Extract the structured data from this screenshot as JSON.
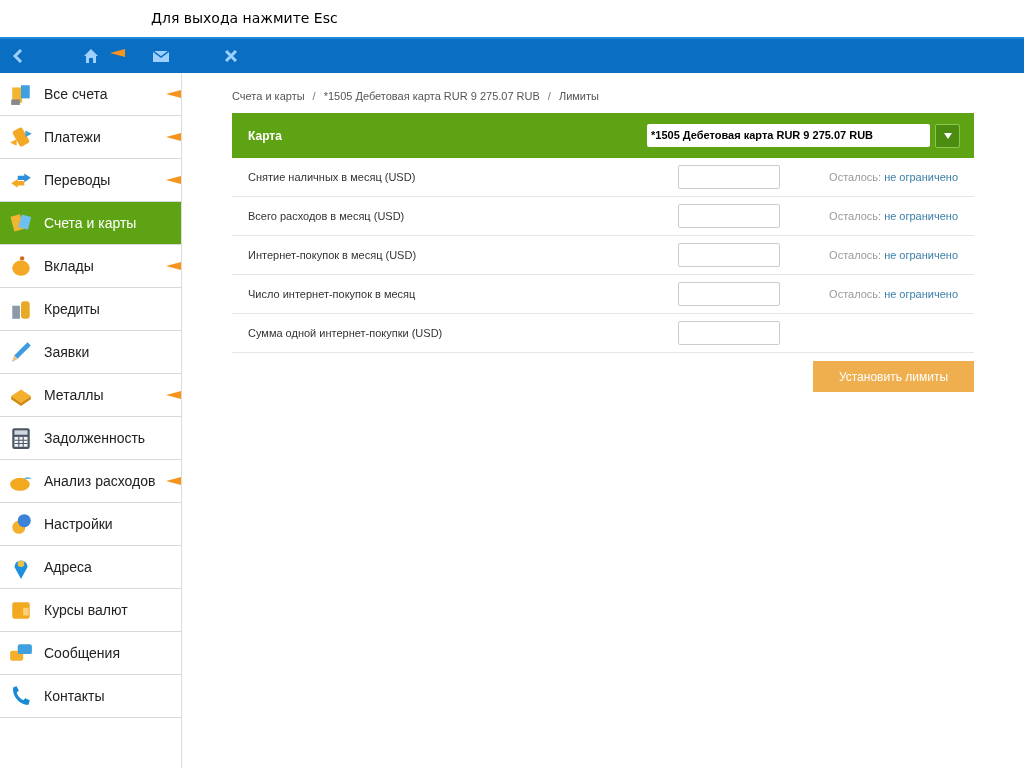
{
  "hint": "Для выхода нажмите Esc",
  "toolbar": {
    "home_marker": true
  },
  "sidebar": {
    "items": [
      {
        "label": "Все счета",
        "selected": false,
        "marker": true
      },
      {
        "label": "Платежи",
        "selected": false,
        "marker": true
      },
      {
        "label": "Переводы",
        "selected": false,
        "marker": true
      },
      {
        "label": "Счета и карты",
        "selected": true,
        "marker": false
      },
      {
        "label": "Вклады",
        "selected": false,
        "marker": true
      },
      {
        "label": "Кредиты",
        "selected": false,
        "marker": false
      },
      {
        "label": "Заявки",
        "selected": false,
        "marker": false
      },
      {
        "label": "Металлы",
        "selected": false,
        "marker": true
      },
      {
        "label": "Задолженность",
        "selected": false,
        "marker": false
      },
      {
        "label": "Анализ расходов",
        "selected": false,
        "marker": true
      },
      {
        "label": "Настройки",
        "selected": false,
        "marker": false
      },
      {
        "label": "Адреса",
        "selected": false,
        "marker": false
      },
      {
        "label": "Курсы валют",
        "selected": false,
        "marker": false
      },
      {
        "label": "Сообщения",
        "selected": false,
        "marker": false
      },
      {
        "label": "Контакты",
        "selected": false,
        "marker": false
      }
    ]
  },
  "breadcrumbs": [
    "Счета и карты",
    "*1505 Дебетовая карта RUR 9 275.07 RUB",
    "Лимиты"
  ],
  "breadcrumb_separators": [
    "/",
    "/"
  ],
  "card_header": {
    "label": "Карта",
    "value": "*1505 Дебетовая карта RUR 9 275.07 RUB"
  },
  "limits": [
    {
      "label": "Снятие наличных в месяц (USD)",
      "remaining_label": "Осталось:",
      "remaining_value": "не ограничено"
    },
    {
      "label": "Всего расходов в месяц (USD)",
      "remaining_label": "Осталось:",
      "remaining_value": "не ограничено"
    },
    {
      "label": "Интернет-покупок в месяц (USD)",
      "remaining_label": "Осталось:",
      "remaining_value": "не ограничено"
    },
    {
      "label": "Число интернет-покупок в месяц",
      "remaining_label": "Осталось:",
      "remaining_value": "не ограничено"
    },
    {
      "label": "Сумма одной интернет-покупки (USD)"
    }
  ],
  "submit_button": "Установить лимиты"
}
